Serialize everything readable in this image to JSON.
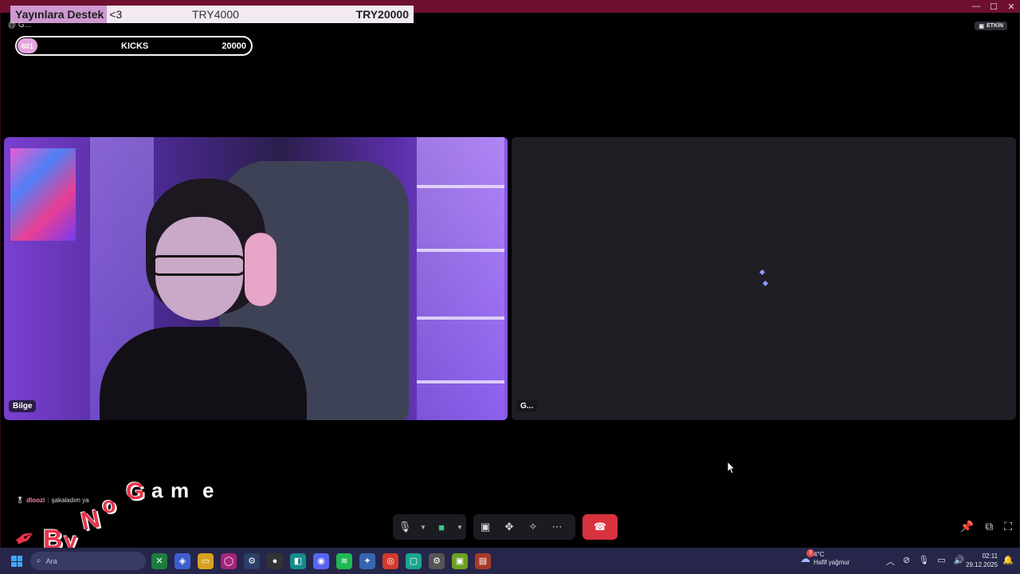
{
  "window": {
    "controls": [
      "—",
      "☐",
      "✕"
    ]
  },
  "overlay": {
    "donation_label": "Yayınlara Destek",
    "donation_hearts": "<3",
    "donation_mid": "TRY4000",
    "donation_goal": "TRY20000",
    "server_tag": "@ G...",
    "kicks_badge": "601",
    "kicks_label": "KICKS",
    "kicks_goal": "20000",
    "active_badge": "ETKİN"
  },
  "tiles": [
    {
      "name": "Bilge"
    },
    {
      "name": "G..."
    }
  ],
  "chat": {
    "user": "dloozi",
    "separator": ":",
    "message": "şakaladım ya"
  },
  "watermark": {
    "letters": [
      "B",
      "y",
      "N",
      "o",
      "G",
      "a",
      "m",
      "e"
    ]
  },
  "controls": {
    "mic_icon": "microphone-icon",
    "camera_icon": "camera-icon",
    "share_icon": "screen-share-icon",
    "activities_icon": "activities-icon",
    "soundboard_icon": "soundboard-icon",
    "more_icon": "more-icon",
    "hangup_icon": "hangup-icon"
  },
  "taskbar": {
    "search_placeholder": "Ara",
    "weather_badge": "3",
    "weather_temp": "4°C",
    "weather_desc": "Hafif yağmur",
    "time": "02:11",
    "date": "29.12.2025",
    "accent": "#42a5f5"
  }
}
